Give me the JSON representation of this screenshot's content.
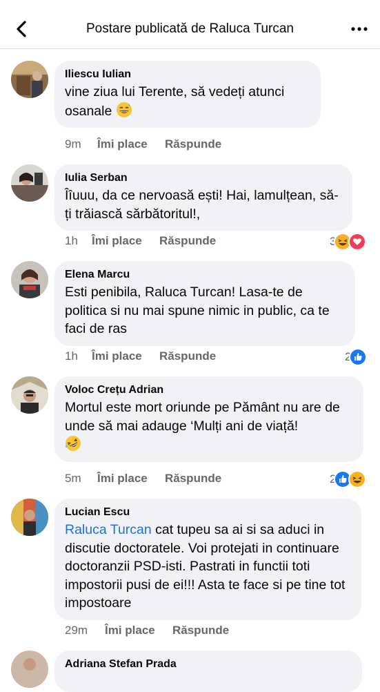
{
  "header": {
    "title": "Postare publicată de Raluca Turcan",
    "back_icon": "chevron-left-icon",
    "more_icon": "ellipsis-icon"
  },
  "colors": {
    "bubble": "#f0f2f5",
    "meta": "#65676b",
    "mention": "#216fdb",
    "like": "#1877f2",
    "love": "#f33e58",
    "haha": "#f7b125"
  },
  "comments": [
    {
      "author": "Iliescu Iulian",
      "text": "vine ziua lui Terente, să vedeți atunci osanale",
      "emoji": "grinning-sweat-emoji",
      "time": "9m",
      "like_label": "Îmi place",
      "reply_label": "Răspunde"
    },
    {
      "author": "Iulia Serban",
      "text": "Îîuuu, da ce nervoasă ești! Hai, lamulțean, să-ți trăiască sărbătoritul!,",
      "time": "1h",
      "like_label": "Îmi place",
      "reply_label": "Răspunde",
      "reaction_count": "3",
      "reactions": [
        "haha-reaction-icon",
        "love-reaction-icon"
      ]
    },
    {
      "author": "Elena Marcu",
      "text": "Esti penibila, Raluca Turcan! Lasa-te de politica si nu mai spune nimic in public, ca te faci de ras",
      "time": "1h",
      "like_label": "Îmi place",
      "reply_label": "Răspunde",
      "reaction_count": "2",
      "reactions": [
        "like-reaction-icon"
      ]
    },
    {
      "author": "Voloc Crețu Adrian",
      "text": "Mortul este mort oriunde pe Pământ nu are de unde să mai adauge ‘Mulți ani de viață!",
      "emoji": "rofl-emoji",
      "time": "5m",
      "like_label": "Îmi place",
      "reply_label": "Răspunde",
      "reaction_count": "2",
      "reactions": [
        "like-reaction-icon",
        "haha-reaction-icon"
      ]
    },
    {
      "author": "Lucian Escu",
      "mention": "Raluca Turcan",
      "text": " cat tupeu sa ai si sa aduci in discutie doctoratele. Voi protejati in continuare doctoranzii PSD-isti. Pastrati in functii toti impostorii pusi de ei!!! Asta te face si pe tine tot impostoare",
      "time": "29m",
      "like_label": "Îmi place",
      "reply_label": "Răspunde"
    },
    {
      "author": "Adriana Stefan Prada"
    }
  ]
}
